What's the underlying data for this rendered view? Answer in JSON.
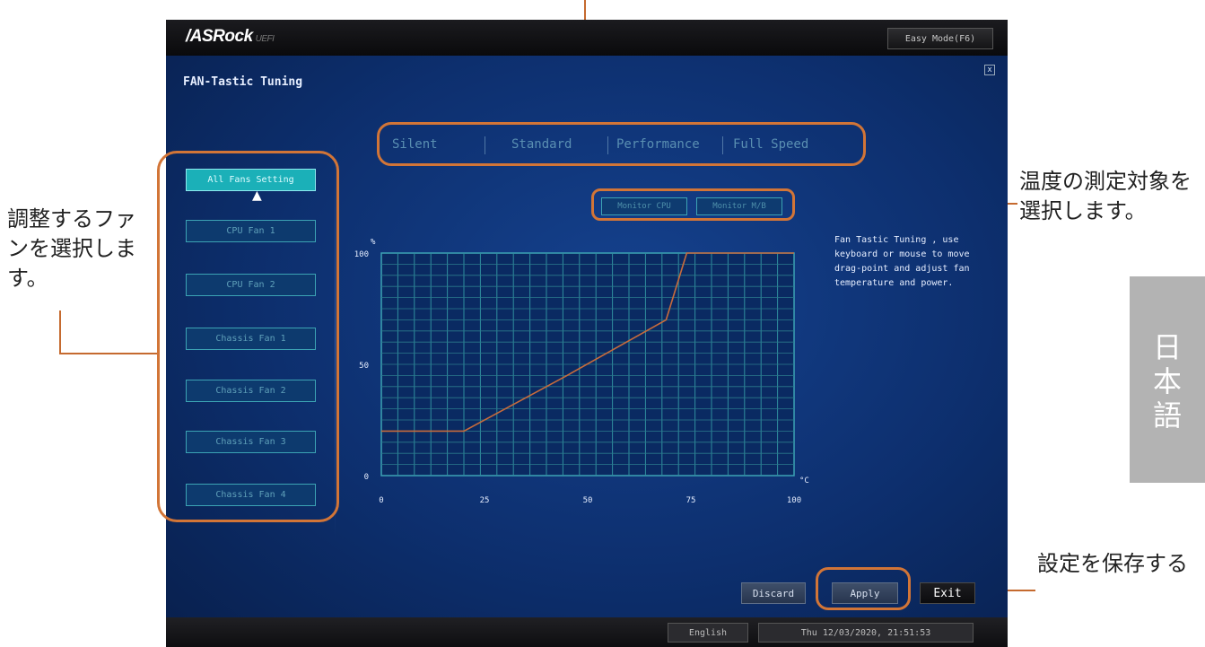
{
  "annotations": {
    "left": "調整するファンを選択します。",
    "temp": "温度の測定対象を選択します。",
    "save": "設定を保存する",
    "side_tab": "日本語"
  },
  "bios": {
    "logo": "/ASRock",
    "logo_sub": "UEFI",
    "easy_mode_label": "Easy Mode(F6)",
    "page_title": "FAN-Tastic Tuning",
    "close_label": "x",
    "fans": [
      {
        "label": "All Fans Setting"
      },
      {
        "label": "CPU Fan 1"
      },
      {
        "label": "CPU Fan 2"
      },
      {
        "label": "Chassis Fan 1"
      },
      {
        "label": "Chassis Fan 2"
      },
      {
        "label": "Chassis Fan 3"
      },
      {
        "label": "Chassis Fan 4"
      }
    ],
    "modes": [
      "Silent",
      "Standard",
      "Performance",
      "Full Speed"
    ],
    "monitor_buttons": [
      "Monitor CPU",
      "Monitor M/B"
    ],
    "description": "Fan Tastic Tuning , use keyboard or mouse to move drag-point and adjust fan temperature and power.",
    "buttons": {
      "discard": "Discard",
      "apply": "Apply",
      "exit": "Exit"
    },
    "language": "English",
    "datetime": "Thu 12/03/2020, 21:51:53"
  },
  "colors": {
    "accent": "#1bb0b8",
    "annotation": "#d27537",
    "curve": "#c76b3c",
    "grid": "#3ca3b4"
  },
  "chart_data": {
    "type": "line",
    "ylabel": "%",
    "xlabel": "°C",
    "xlim": [
      0,
      100
    ],
    "ylim": [
      0,
      100
    ],
    "x_ticks": [
      "0",
      "25",
      "50",
      "75",
      "100"
    ],
    "y_ticks": [
      "0",
      "50",
      "100"
    ],
    "series": [
      {
        "x": [
          0,
          20,
          45,
          69,
          74,
          100
        ],
        "y": [
          20,
          20,
          45,
          70,
          100,
          100
        ]
      }
    ]
  }
}
